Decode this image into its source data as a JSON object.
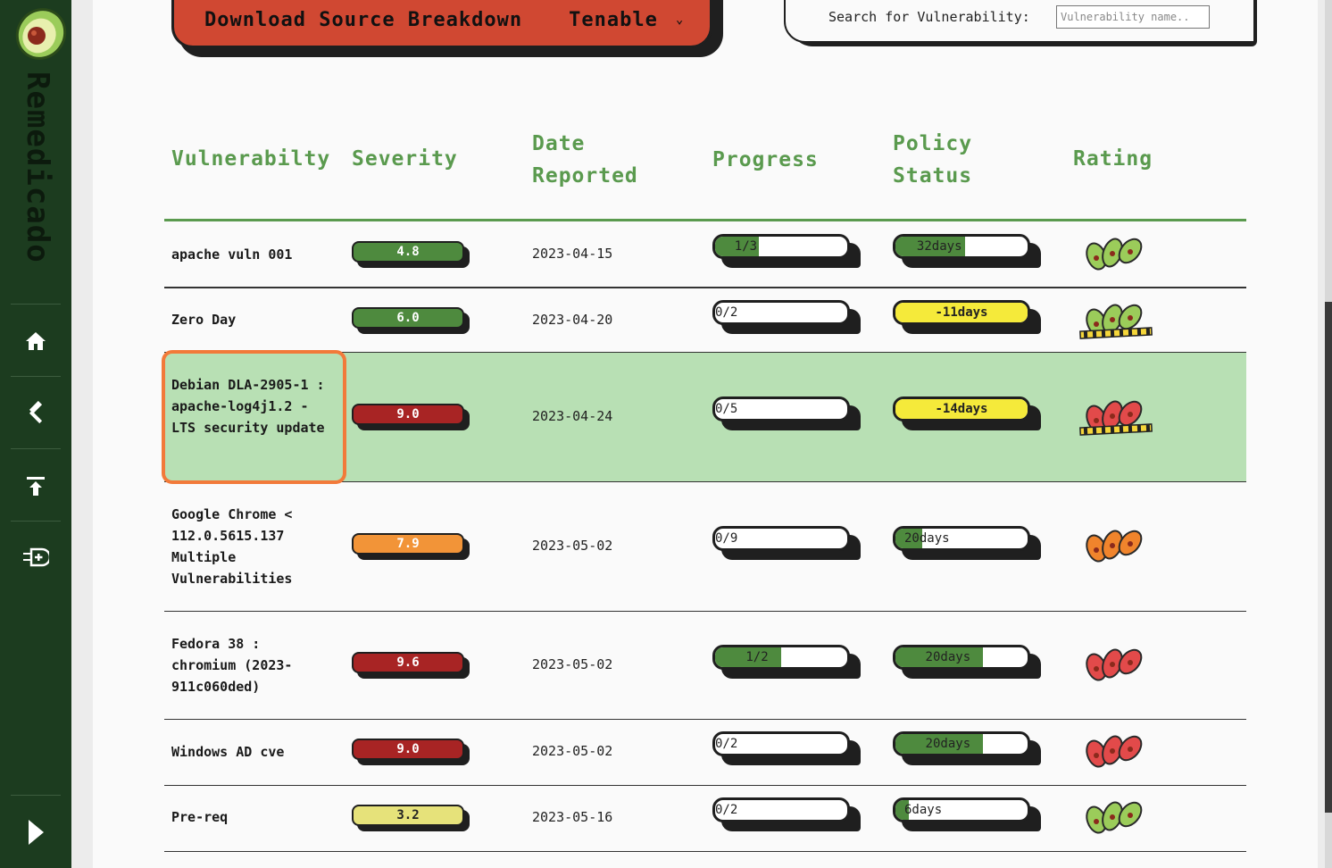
{
  "app": {
    "brand": "Remedicado"
  },
  "toolbar": {
    "download_label": "Download Source Breakdown",
    "source_value": "Tenable",
    "search_label": "Search for Vulnerability:",
    "search_placeholder": "Vulnerability name.."
  },
  "sidebar": {
    "items": [
      {
        "name": "home",
        "icon": "home-icon"
      },
      {
        "name": "tools",
        "icon": "hammer-icon"
      },
      {
        "name": "upload",
        "icon": "upload-icon"
      },
      {
        "name": "add",
        "icon": "add-ticket-icon"
      },
      {
        "name": "expand",
        "icon": "play-icon"
      }
    ]
  },
  "table": {
    "headers": {
      "vulnerability": "Vulnerabilty",
      "severity": "Severity",
      "date_line1": "Date",
      "date_line2": "Reported",
      "progress": "Progress",
      "policy_line1": "Policy",
      "policy_line2": "Status",
      "rating": "Rating"
    },
    "rows": [
      {
        "name": "apache vuln 001",
        "severity": "4.8",
        "severity_color": "#4e8a3e",
        "date": "2023-04-15",
        "progress": "1/3",
        "progress_frac": 0.33,
        "policy": "32days",
        "policy_frac": 0.53,
        "policy_color": "#4e8a3e",
        "rating_color": "green",
        "rating_tape": false
      },
      {
        "name": "Zero Day",
        "severity": "6.0",
        "severity_color": "#4e8a3e",
        "date": "2023-04-20",
        "progress": "0/2",
        "progress_frac": 0,
        "policy": "-11days",
        "policy_frac": 1,
        "policy_color": "#f5ea3a",
        "rating_color": "green",
        "rating_tape": true
      },
      {
        "name": "Debian DLA-2905-1 : apache-log4j1.2 - LTS security update",
        "severity": "9.0",
        "severity_color": "#a82424",
        "date": "2023-04-24",
        "progress": "0/5",
        "progress_frac": 0,
        "policy": "-14days",
        "policy_frac": 1,
        "policy_color": "#f5ea3a",
        "rating_color": "red",
        "rating_tape": true
      },
      {
        "name": "Google Chrome < 112.0.5615.137 Multiple Vulnerabilities",
        "severity": "7.9",
        "severity_color": "#f29438",
        "date": "2023-05-02",
        "progress": "0/9",
        "progress_frac": 0,
        "policy": "20days",
        "policy_frac": 0.2,
        "policy_color": "#4e8a3e",
        "rating_color": "orange",
        "rating_tape": false
      },
      {
        "name": "Fedora 38 : chromium (2023-911c060ded)",
        "severity": "9.6",
        "severity_color": "#a82424",
        "date": "2023-05-02",
        "progress": "1/2",
        "progress_frac": 0.5,
        "policy": "20days",
        "policy_frac": 0.66,
        "policy_color": "#4e8a3e",
        "rating_color": "red",
        "rating_tape": false
      },
      {
        "name": "Windows AD cve",
        "severity": "9.0",
        "severity_color": "#a82424",
        "date": "2023-05-02",
        "progress": "0/2",
        "progress_frac": 0,
        "policy": "20days",
        "policy_frac": 0.66,
        "policy_color": "#4e8a3e",
        "rating_color": "red",
        "rating_tape": false
      },
      {
        "name": "Pre-req",
        "severity": "3.2",
        "severity_color": "#e6e27a",
        "date": "2023-05-16",
        "progress": "0/2",
        "progress_frac": 0,
        "policy": "6days",
        "policy_frac": 0.1,
        "policy_color": "#4e8a3e",
        "rating_color": "green",
        "rating_tape": false
      }
    ]
  }
}
